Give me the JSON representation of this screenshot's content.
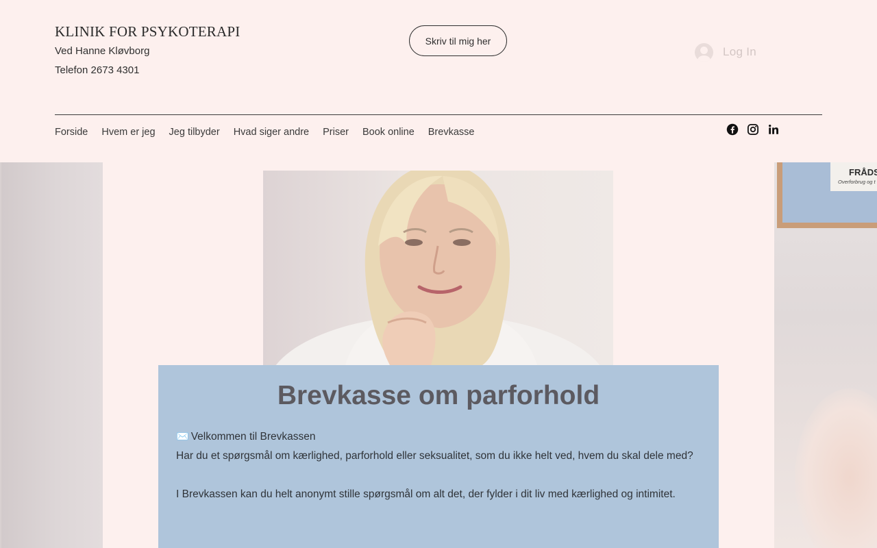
{
  "header": {
    "site_title": "KLINIK FOR PSYKOTERAPI",
    "subtitle": "Ved Hanne Kløvborg",
    "phone": "Telefon 2673 4301",
    "cta_label": "Skriv til mig her",
    "login_label": "Log In"
  },
  "nav": {
    "items": [
      {
        "label": "Forside"
      },
      {
        "label": "Hvem er jeg"
      },
      {
        "label": "Jeg tilbyder"
      },
      {
        "label": "Hvad siger andre"
      },
      {
        "label": "Priser"
      },
      {
        "label": "Book online"
      },
      {
        "label": "Brevkasse"
      }
    ]
  },
  "social": [
    "facebook-icon",
    "instagram-icon",
    "linkedin-icon"
  ],
  "hero": {
    "frame_text": "FRÅDSE",
    "frame_subtext": "Overforbrug og t"
  },
  "panel": {
    "heading": "Brevkasse om parforhold",
    "icon": "✉️",
    "welcome": "Velkommen til Brevkassen",
    "paragraph1": "Har du et spørgsmål om kærlighed, parforhold eller seksualitet, som du ikke helt ved, hvem du skal dele med?",
    "paragraph2": "I Brevkassen kan du helt anonymt stille spørgsmål om alt det, der fylder i dit liv med kærlighed og intimitet."
  },
  "colors": {
    "page_bg": "#fdf0ee",
    "panel_bg": "#afc5db",
    "heading_color": "#5c5a60"
  }
}
